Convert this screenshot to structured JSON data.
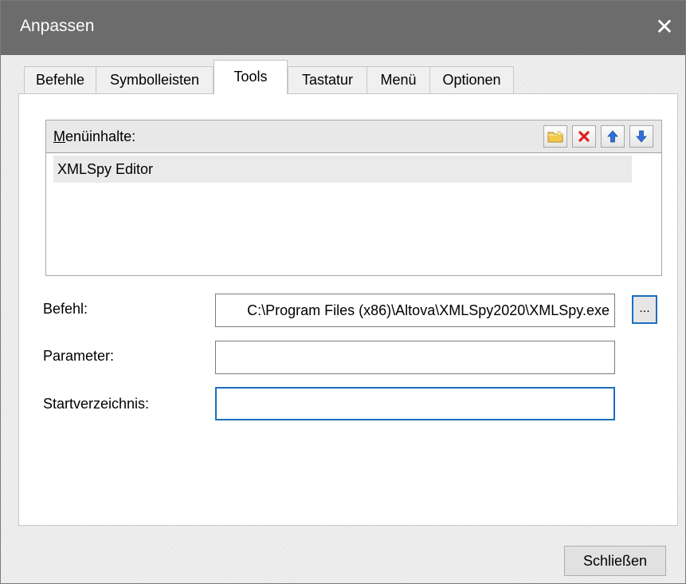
{
  "window": {
    "title": "Anpassen",
    "close_glyph": "✕"
  },
  "tabs": [
    {
      "label": "Befehle",
      "active": false
    },
    {
      "label": "Symbolleisten",
      "active": false
    },
    {
      "label": "Tools",
      "active": true
    },
    {
      "label": "Tastatur",
      "active": false
    },
    {
      "label": "Menü",
      "active": false
    },
    {
      "label": "Optionen",
      "active": false
    }
  ],
  "menu_contents": {
    "label_mnemonic": "M",
    "label_rest": "enüinhalte:",
    "toolbar": {
      "icons": [
        "new-folder-icon",
        "delete-icon",
        "move-up-icon",
        "move-down-icon"
      ]
    },
    "items": [
      "XMLSpy Editor"
    ]
  },
  "form": {
    "command_label": "Befehl:",
    "command_value": "C:\\Program Files (x86)\\Altova\\XMLSpy2020\\XMLSpy.exe",
    "browse_label": "...",
    "parameter_label": "Parameter:",
    "parameter_value": "",
    "start_dir_label": "Startverzeichnis:",
    "start_dir_value": ""
  },
  "footer": {
    "close_label": "Schließen"
  },
  "colors": {
    "titlebar": "#6c6c6c",
    "focus_accent": "#1b6fbf",
    "delete_red": "#e02020",
    "arrow_blue": "#2f6fd6",
    "folder_yellow": "#f2c94c"
  }
}
